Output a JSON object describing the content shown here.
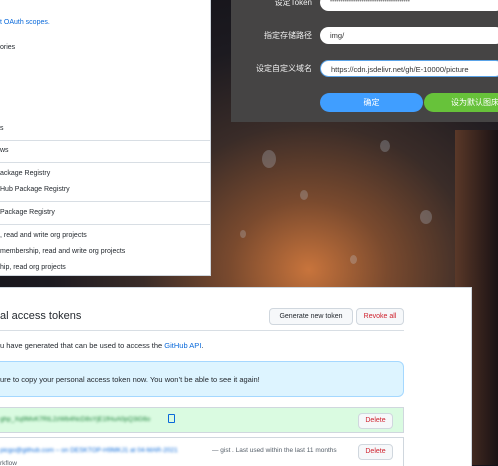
{
  "scopes": {
    "rows": [
      {
        "text": "t OAuth scopes.",
        "link": true
      },
      {
        "text": "ories",
        "link": false
      },
      {
        "text": "s",
        "link": false
      },
      {
        "text": "ws",
        "link": false
      },
      {
        "text": "ackage Registry",
        "link": false
      },
      {
        "text": "Hub Package Registry",
        "link": false
      },
      {
        "text": "Package Registry",
        "link": false
      },
      {
        "text": ", read and write org projects",
        "link": false
      },
      {
        "text": "membership, read and write org projects",
        "link": false
      },
      {
        "text": "hip, read org projects",
        "link": false
      }
    ]
  },
  "dialog": {
    "token_label": "设定Token",
    "token_value": "••••••••••••••••••••••••••••••••••••••",
    "path_label": "指定存储路径",
    "path_value": "img/",
    "domain_label": "设定自定义域名",
    "domain_value": "https://cdn.jsdelivr.net/gh/E-10000/picture",
    "confirm_label": "确定",
    "default_label": "设为默认图床",
    "colors": {
      "confirm": "#409eff",
      "default": "#67c23a",
      "bg": "#454444"
    }
  },
  "tokens": {
    "title": "al access tokens",
    "generate_label": "Generate new token",
    "revoke_label": "Revoke all",
    "description_prefix": "u have generated that can be used to access the ",
    "description_link": "GitHub API",
    "description_suffix": ".",
    "flash": "ure to copy your personal access token now. You won’t be able to see it again!",
    "new_token_blurred": "ghp_Xq9MvK7RtL2zWb4NcD8sYjE1fHuA0pQ3iG6o",
    "delete_label": "Delete",
    "second_token_blurred": "picgo@github.com – on DESKTOP-H9MKJ1 at 04-MAR-2021",
    "second_token_scope": "— gist",
    "second_token_used": ". Last used within the last 11 months",
    "workflow_label": "rkflow"
  }
}
